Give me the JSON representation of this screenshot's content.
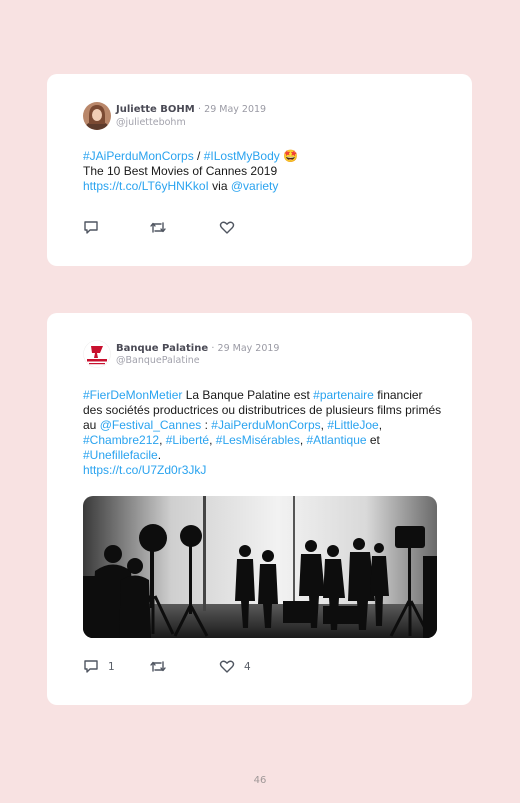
{
  "tweets": [
    {
      "name": "Juliette BOHM",
      "separator": "·",
      "date": "29 May 2019",
      "handle": "@juliettebohm",
      "line1_tag1": "#JAiPerduMonCorps",
      "line1_sep": " / ",
      "line1_tag2": "#ILostMyBody",
      "emoji": "🤩",
      "line2": "The 10 Best Movies of Cannes 2019",
      "link": "https://t.co/LT6yHNKkoI",
      "via": " via ",
      "mention": "@variety",
      "icons": [
        "reply-icon",
        "retweet-icon",
        "heart-icon"
      ]
    },
    {
      "name": "Banque Palatine",
      "separator": "·",
      "date": "29 May 2019",
      "handle": "@BanquePalatine",
      "tag_fier": "#FierDeMonMetier",
      "text_a": " La Banque Palatine est ",
      "tag_partenaire": "#partenaire",
      "text_b": " financier des sociétés productrices ou distributrices de plusieurs films primés au ",
      "mention_festival": "@Festival_Cannes",
      "text_c": " : ",
      "tag_1": "#JaiPerduMonCorps",
      "comma_1": ", ",
      "tag_2": "#LittleJoe",
      "comma_2": ", ",
      "tag_3": "#Chambre212",
      "comma_3": ", ",
      "tag_4": "#Liberté",
      "comma_4": ", ",
      "tag_5": "#LesMisérables",
      "comma_5": ", ",
      "tag_6": "#Atlantique",
      "text_et": " et ",
      "tag_7": "#Unefillefacile",
      "period": ".",
      "link": "https://t.co/U7Zd0r3JkJ",
      "reply_count": "1",
      "like_count": "4",
      "icons": [
        "reply-icon",
        "retweet-icon",
        "heart-icon"
      ]
    }
  ],
  "page_number": "46"
}
